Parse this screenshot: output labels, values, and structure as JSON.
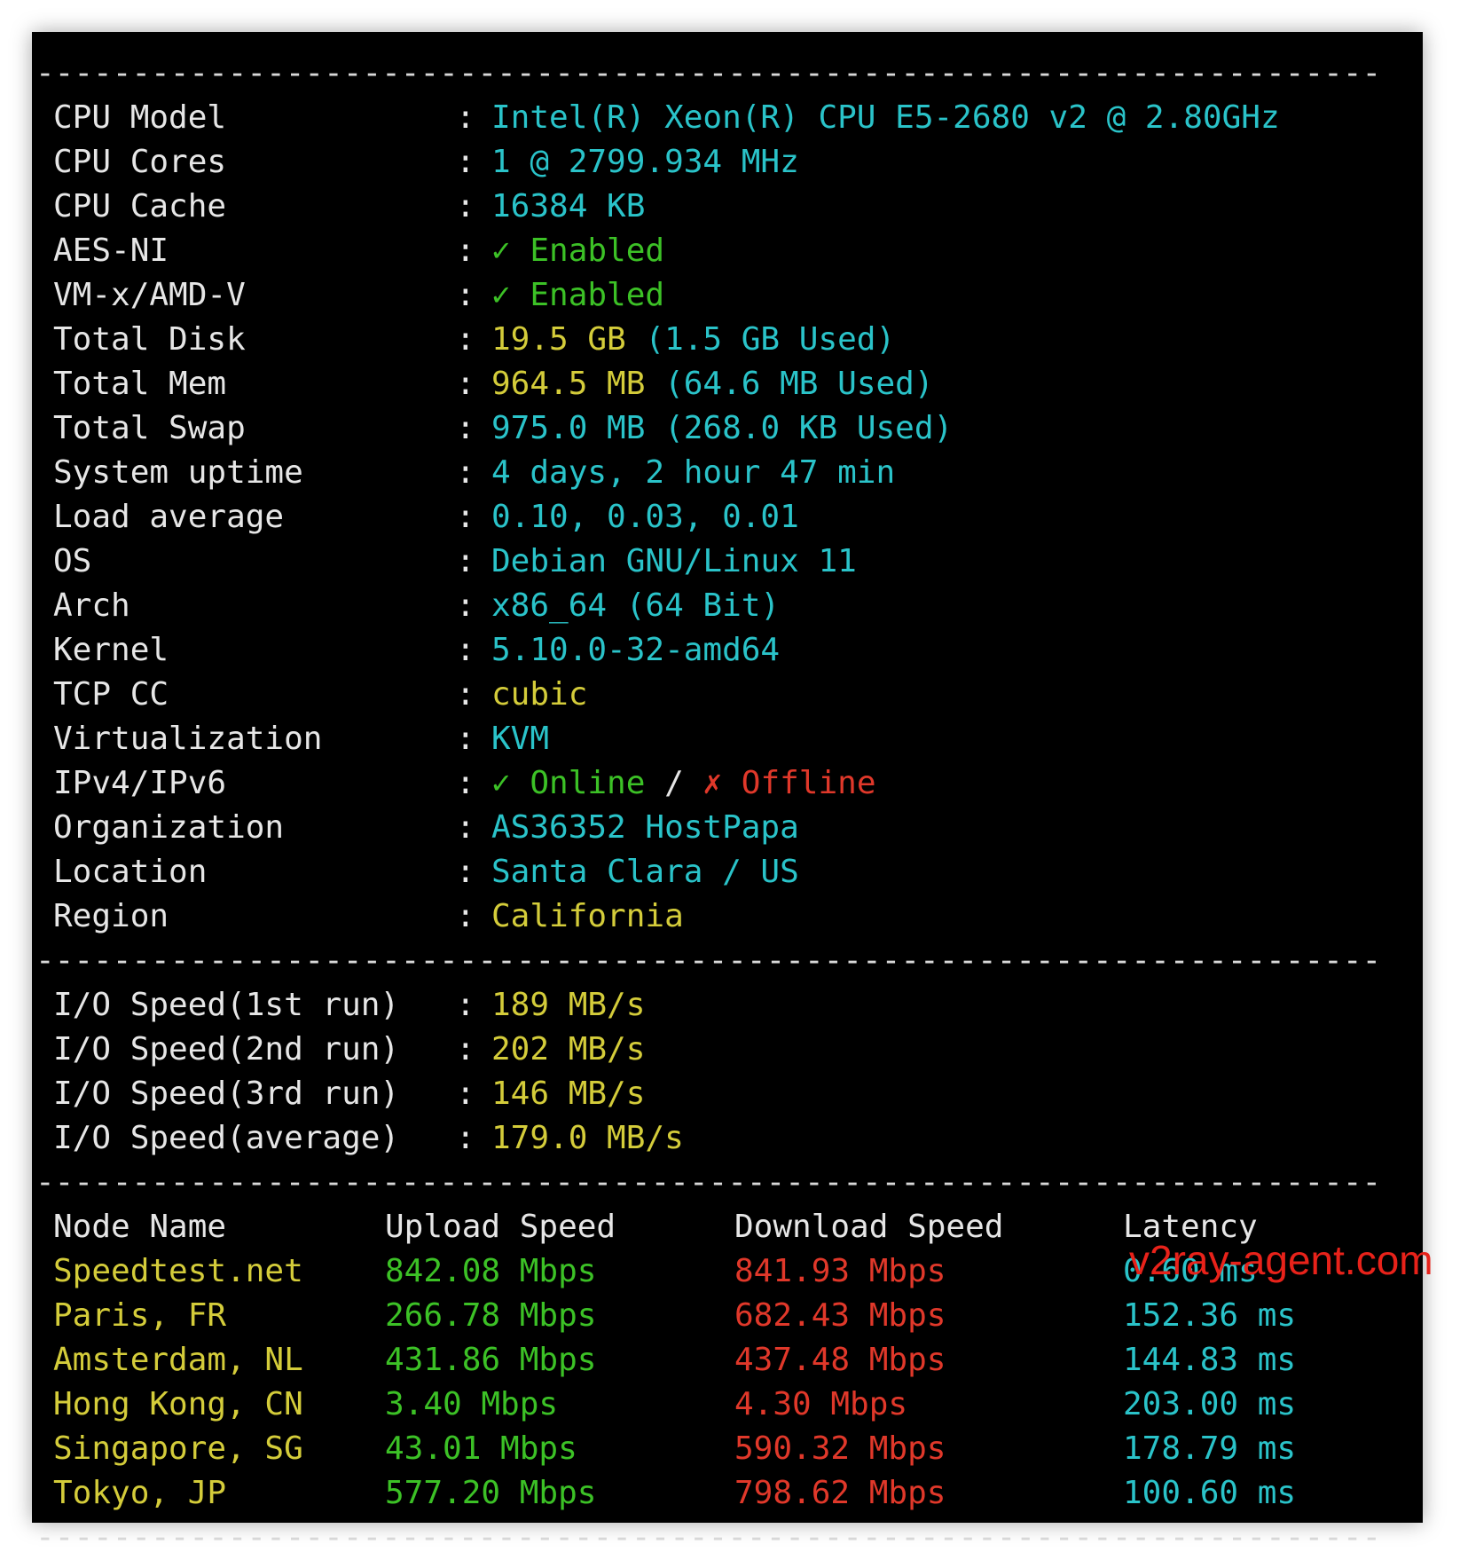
{
  "separator": "----------------------------------------------------------------------",
  "info": [
    {
      "label": "CPU Model",
      "parts": [
        {
          "text": "Intel(R) Xeon(R) CPU E5-2680 v2 @ 2.80GHz",
          "color": "cyan"
        }
      ]
    },
    {
      "label": "CPU Cores",
      "parts": [
        {
          "text": "1 @ 2799.934 MHz",
          "color": "cyan"
        }
      ]
    },
    {
      "label": "CPU Cache",
      "parts": [
        {
          "text": "16384 KB",
          "color": "cyan"
        }
      ]
    },
    {
      "label": "AES-NI",
      "parts": [
        {
          "text": "✓ Enabled",
          "color": "green"
        }
      ]
    },
    {
      "label": "VM-x/AMD-V",
      "parts": [
        {
          "text": "✓ Enabled",
          "color": "green"
        }
      ]
    },
    {
      "label": "Total Disk",
      "parts": [
        {
          "text": "19.5 GB ",
          "color": "yellow"
        },
        {
          "text": "(1.5 GB Used)",
          "color": "cyan"
        }
      ]
    },
    {
      "label": "Total Mem",
      "parts": [
        {
          "text": "964.5 MB ",
          "color": "yellow"
        },
        {
          "text": "(64.6 MB Used)",
          "color": "cyan"
        }
      ]
    },
    {
      "label": "Total Swap",
      "parts": [
        {
          "text": "975.0 MB ",
          "color": "cyan"
        },
        {
          "text": "(268.0 KB Used)",
          "color": "cyan"
        }
      ]
    },
    {
      "label": "System uptime",
      "parts": [
        {
          "text": "4 days, 2 hour 47 min",
          "color": "cyan"
        }
      ]
    },
    {
      "label": "Load average",
      "parts": [
        {
          "text": "0.10, 0.03, 0.01",
          "color": "cyan"
        }
      ]
    },
    {
      "label": "OS",
      "parts": [
        {
          "text": "Debian GNU/Linux 11",
          "color": "cyan"
        }
      ]
    },
    {
      "label": "Arch",
      "parts": [
        {
          "text": "x86_64 (64 Bit)",
          "color": "cyan"
        }
      ]
    },
    {
      "label": "Kernel",
      "parts": [
        {
          "text": "5.10.0-32-amd64",
          "color": "cyan"
        }
      ]
    },
    {
      "label": "TCP CC",
      "parts": [
        {
          "text": "cubic",
          "color": "yellow"
        }
      ]
    },
    {
      "label": "Virtualization",
      "parts": [
        {
          "text": "KVM",
          "color": "cyan"
        }
      ]
    },
    {
      "label": "IPv4/IPv6",
      "parts": [
        {
          "text": "✓ Online",
          "color": "green"
        },
        {
          "text": " / ",
          "color": "white"
        },
        {
          "text": "✗ Offline",
          "color": "red"
        }
      ]
    },
    {
      "label": "Organization",
      "parts": [
        {
          "text": "AS36352 HostPapa",
          "color": "cyan"
        }
      ]
    },
    {
      "label": "Location",
      "parts": [
        {
          "text": "Santa Clara / US",
          "color": "cyan"
        }
      ]
    },
    {
      "label": "Region",
      "parts": [
        {
          "text": "California",
          "color": "yellow"
        }
      ]
    }
  ],
  "io": [
    {
      "label": "I/O Speed(1st run)",
      "value": "189 MB/s"
    },
    {
      "label": "I/O Speed(2nd run)",
      "value": "202 MB/s"
    },
    {
      "label": "I/O Speed(3rd run)",
      "value": "146 MB/s"
    },
    {
      "label": "I/O Speed(average)",
      "value": "179.0 MB/s"
    }
  ],
  "speed_headers": [
    "Node Name",
    "Upload Speed",
    "Download Speed",
    "Latency"
  ],
  "speed": [
    {
      "node": "Speedtest.net",
      "upload": "842.08 Mbps",
      "download": "841.93 Mbps",
      "latency": "0.60 ms"
    },
    {
      "node": "Paris, FR",
      "upload": "266.78 Mbps",
      "download": "682.43 Mbps",
      "latency": "152.36 ms"
    },
    {
      "node": "Amsterdam, NL",
      "upload": "431.86 Mbps",
      "download": "437.48 Mbps",
      "latency": "144.83 ms"
    },
    {
      "node": "Hong Kong, CN",
      "upload": "3.40 Mbps",
      "download": "4.30 Mbps",
      "latency": "203.00 ms"
    },
    {
      "node": "Singapore, SG",
      "upload": "43.01 Mbps",
      "download": "590.32 Mbps",
      "latency": "178.79 ms"
    },
    {
      "node": "Tokyo, JP",
      "upload": "577.20 Mbps",
      "download": "798.62 Mbps",
      "latency": "100.60 ms"
    }
  ],
  "watermark": "v2ray-agent.com",
  "colors": {
    "cyan": "#2ac3c9",
    "yellow": "#d4cc3a",
    "green": "#3cc126",
    "red": "#e0382a",
    "white": "#e6e6e6"
  }
}
